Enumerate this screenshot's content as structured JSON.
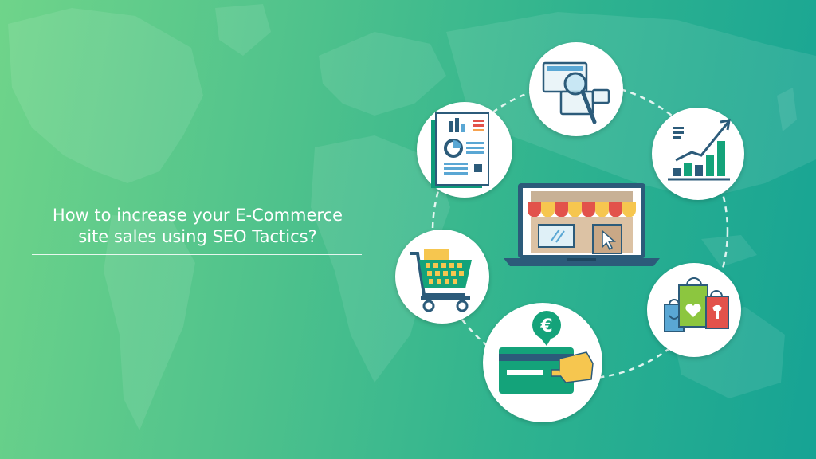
{
  "headline": {
    "line1": "How to increase your E-Commerce",
    "line2": "site sales using SEO Tactics?"
  },
  "colors": {
    "background_start": "#6fd48a",
    "background_end": "#16a394",
    "accent_green": "#14a37a",
    "awning_red": "#e2524b",
    "awning_yellow": "#f6c64f"
  },
  "icons": [
    "search-analysis-icon",
    "report-document-icon",
    "growth-chart-icon",
    "storefront-laptop-icon",
    "shopping-cart-icon",
    "shopping-bags-icon",
    "card-payment-icon"
  ],
  "payment": {
    "currency_symbol": "€"
  }
}
